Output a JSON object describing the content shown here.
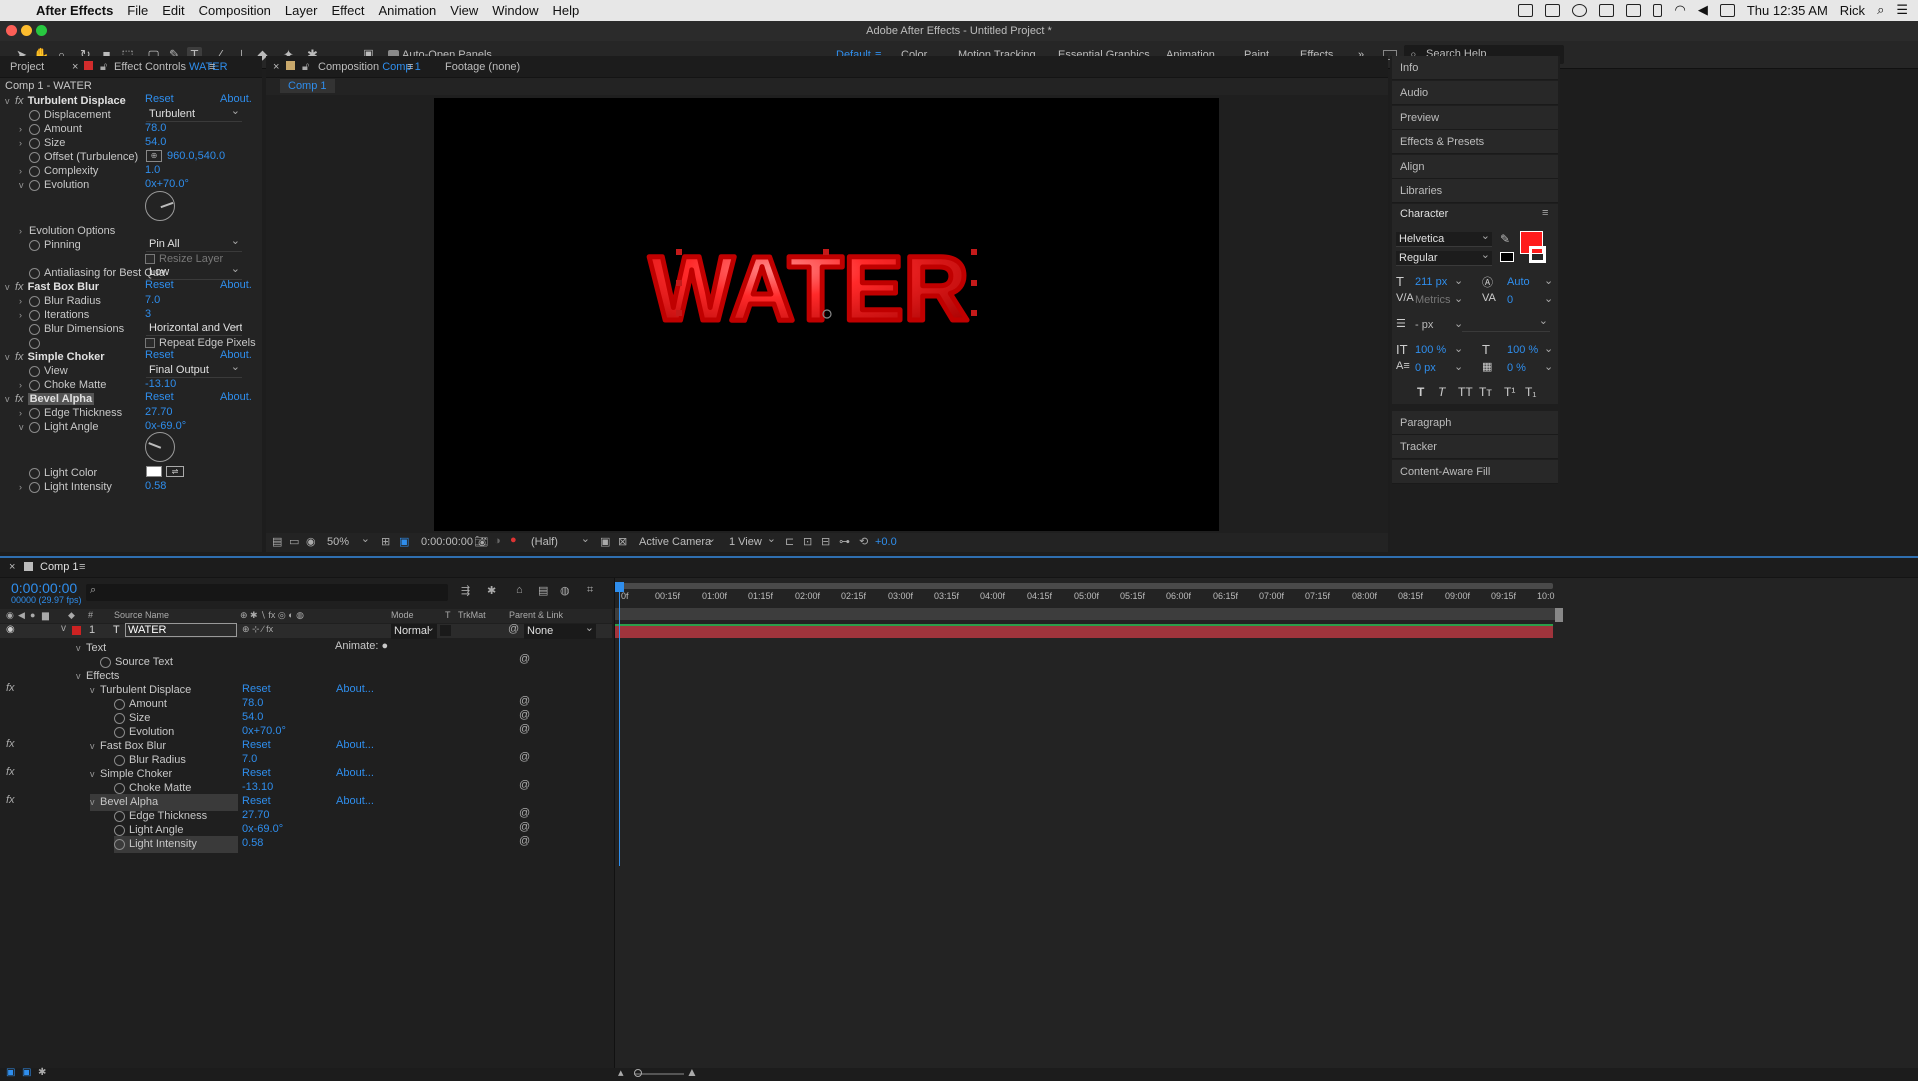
{
  "menubar": {
    "app_name": "After Effects",
    "items": [
      "File",
      "Edit",
      "Composition",
      "Layer",
      "Effect",
      "Animation",
      "View",
      "Window",
      "Help"
    ],
    "clock": "Thu 12:35 AM",
    "user": "Rick"
  },
  "window": {
    "title": "Adobe After Effects - Untitled Project *"
  },
  "toolbar": {
    "auto_open_label": "Auto-Open Panels",
    "workspaces": [
      "Default",
      "Color",
      "Motion Tracking",
      "Essential Graphics",
      "Animation",
      "Paint",
      "Effects"
    ],
    "active_workspace": "Default",
    "search_placeholder": "Search Help"
  },
  "left_panel": {
    "tab_project": "Project",
    "tab_effect_controls_prefix": "Effect Controls",
    "tab_effect_controls_layer": "WATER",
    "layer_path": "Comp 1 - WATER",
    "reset": "Reset",
    "about": "About.",
    "turbulent": {
      "name": "Turbulent Displace",
      "displacement_label": "Displacement",
      "displacement_value": "Turbulent",
      "amount_label": "Amount",
      "amount_value": "78.0",
      "size_label": "Size",
      "size_value": "54.0",
      "offset_label": "Offset (Turbulence)",
      "offset_value": "960.0,540.0",
      "complexity_label": "Complexity",
      "complexity_value": "1.0",
      "evolution_label": "Evolution",
      "evolution_value": "0x+70.0°",
      "evolution_options_label": "Evolution Options",
      "pinning_label": "Pinning",
      "pinning_value": "Pin All",
      "resize_layer_label": "Resize Layer",
      "antialias_label": "Antialiasing for Best Qua",
      "antialias_value": "Low"
    },
    "fastblur": {
      "name": "Fast Box Blur",
      "radius_label": "Blur Radius",
      "radius_value": "7.0",
      "iterations_label": "Iterations",
      "iterations_value": "3",
      "dimensions_label": "Blur Dimensions",
      "dimensions_value": "Horizontal and Verti",
      "repeat_label": "Repeat Edge Pixels"
    },
    "choker": {
      "name": "Simple Choker",
      "view_label": "View",
      "view_value": "Final Output",
      "choke_label": "Choke Matte",
      "choke_value": "-13.10"
    },
    "bevel": {
      "name": "Bevel Alpha",
      "edge_label": "Edge Thickness",
      "edge_value": "27.70",
      "angle_label": "Light Angle",
      "angle_value": "0x-69.0°",
      "color_label": "Light Color",
      "intensity_label": "Light Intensity",
      "intensity_value": "0.58"
    }
  },
  "comp_panel": {
    "tab_prefix": "Composition",
    "tab_comp": "Comp 1",
    "footage_tab": "Footage (none)",
    "flow_label": "Comp 1",
    "canvas_text": "WATER",
    "zoom": "50%",
    "timecode": "0:00:00:00",
    "resolution": "(Half)",
    "camera": "Active Camera",
    "views": "1 View",
    "exposure": "+0.0"
  },
  "right_panel": {
    "items": [
      "Info",
      "Audio",
      "Preview",
      "Effects & Presets",
      "Align",
      "Libraries"
    ],
    "character_title": "Character",
    "font_family": "Helvetica",
    "font_style": "Regular",
    "font_size": "211 px",
    "leading": "Auto",
    "kerning": "Metrics",
    "tracking": "0",
    "stroke_width": "- px",
    "vert_scale": "100 %",
    "horiz_scale": "100 %",
    "baseline": "0 px",
    "tsume": "0 %",
    "fill_color": "#ff1c1c",
    "bottom_items": [
      "Paragraph",
      "Tracker",
      "Content-Aware Fill"
    ]
  },
  "timeline": {
    "tab": "Comp 1",
    "timecode": "0:00:00:00",
    "frame_info": "00000 (29.97 fps)",
    "col_source": "Source Name",
    "col_mode": "Mode",
    "col_t": "T",
    "col_trkmat": "TrkMat",
    "col_parent": "Parent & Link",
    "layer_num": "1",
    "layer_name": "WATER",
    "layer_mode": "Normal",
    "layer_parent": "None",
    "ruler": [
      "0f",
      "00:15f",
      "01:00f",
      "01:15f",
      "02:00f",
      "02:15f",
      "03:00f",
      "03:15f",
      "04:00f",
      "04:15f",
      "05:00f",
      "05:15f",
      "06:00f",
      "06:15f",
      "07:00f",
      "07:15f",
      "08:00f",
      "08:15f",
      "09:00f",
      "09:15f",
      "10:0"
    ],
    "rows": {
      "text": "Text",
      "animate": "Animate:",
      "source_text": "Source Text",
      "effects": "Effects",
      "turb": "Turbulent Displace",
      "amount": "Amount",
      "amount_v": "78.0",
      "size": "Size",
      "size_v": "54.0",
      "evolution": "Evolution",
      "evolution_v": "0x+70.0°",
      "blur": "Fast Box Blur",
      "radius": "Blur Radius",
      "radius_v": "7.0",
      "choker": "Simple Choker",
      "choke": "Choke Matte",
      "choke_v": "-13.10",
      "bevel": "Bevel Alpha",
      "edge": "Edge Thickness",
      "edge_v": "27.70",
      "angle": "Light Angle",
      "angle_v": "0x-69.0°",
      "intensity": "Light Intensity",
      "intensity_v": "0.58",
      "reset": "Reset",
      "about": "About..."
    }
  }
}
